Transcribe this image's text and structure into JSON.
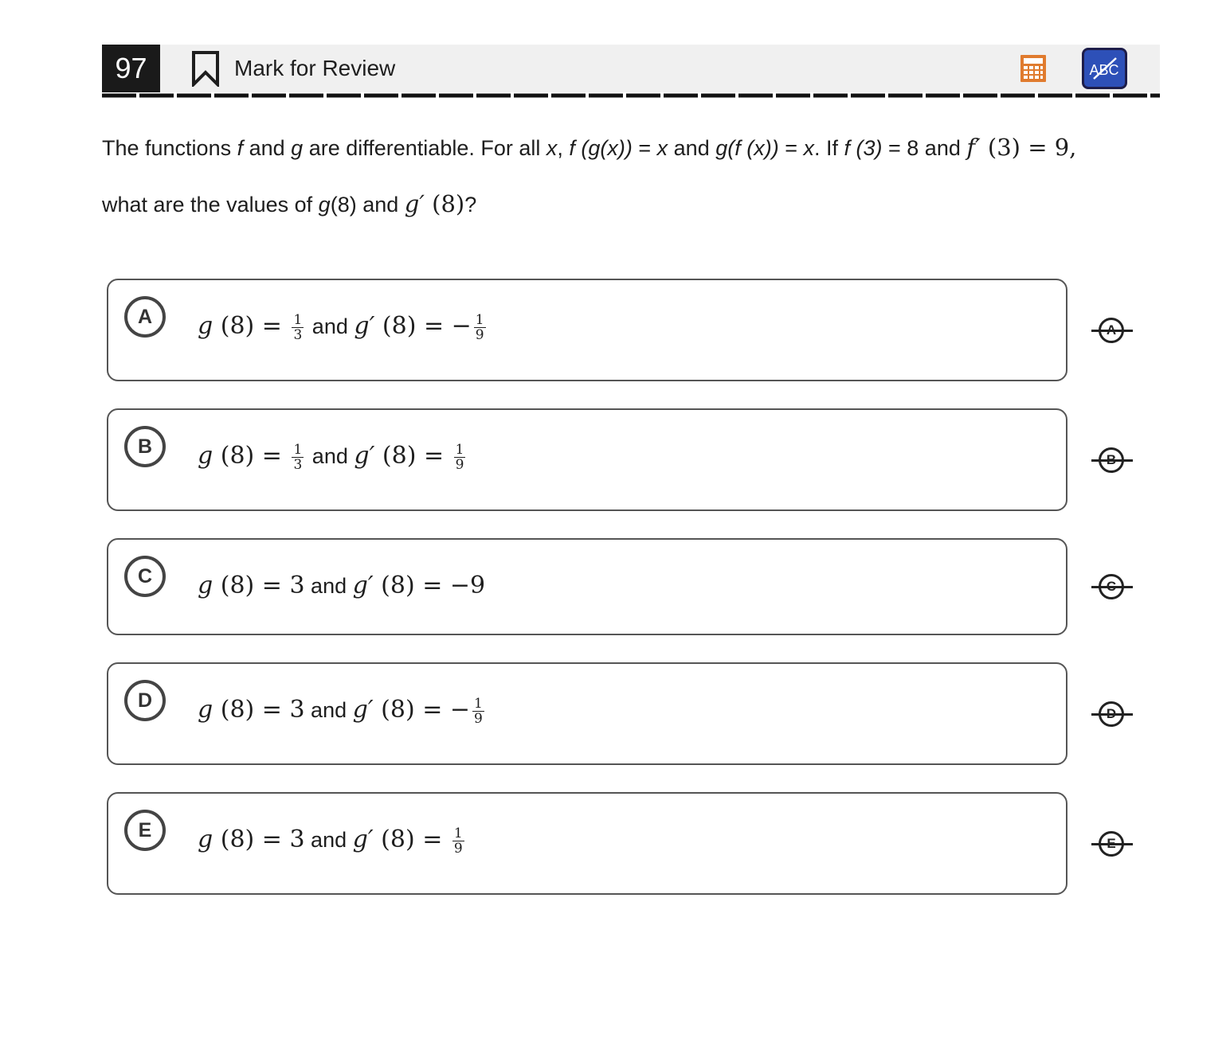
{
  "header": {
    "question_number": "97",
    "mark_label": "Mark for Review",
    "calculator_icon": "calculator-icon",
    "abc_icon": "abc-strikethrough-icon",
    "abc_text": "ABC",
    "accent_orange": "#e07b2e",
    "accent_blue": "#2d50b8"
  },
  "question": {
    "t1": "The functions ",
    "f": "f",
    "t2": " and ",
    "g": "g",
    "t3": " are differentiable. For all ",
    "x1": "x",
    "t4": ", ",
    "fg": "f (g(x))",
    "t5": " = ",
    "x2": "x",
    "t6": " and ",
    "gf": "g(f (x))",
    "t7": " = ",
    "x3": "x",
    "t8": ". If ",
    "f3": "f (3)",
    "t9": " = 8 and ",
    "fp": "f′",
    "fp3": " (3) = 9,",
    "t10": "what are the values of ",
    "g8": "g",
    "g8b": "(8) and ",
    "gp": "g′",
    "gp8": " (8)",
    "t11": "?"
  },
  "choices": [
    {
      "letter": "A",
      "lhs": "g",
      "lhs_arg": " (8) = ",
      "lhs_frac": {
        "num": "1",
        "den": "3"
      },
      "mid": " and ",
      "gp": "g′",
      "rhs_arg": " (8) = −",
      "rhs_frac": {
        "num": "1",
        "den": "9"
      }
    },
    {
      "letter": "B",
      "lhs": "g",
      "lhs_arg": " (8) = ",
      "lhs_frac": {
        "num": "1",
        "den": "3"
      },
      "mid": " and ",
      "gp": "g′",
      "rhs_arg": " (8) = ",
      "rhs_frac": {
        "num": "1",
        "den": "9"
      }
    },
    {
      "letter": "C",
      "lhs": "g",
      "lhs_arg": " (8) = 3",
      "mid": " and ",
      "gp": "g′",
      "rhs_arg": " (8) = −9"
    },
    {
      "letter": "D",
      "lhs": "g",
      "lhs_arg": " (8) = 3",
      "mid": " and ",
      "gp": "g′",
      "rhs_arg": " (8) = −",
      "rhs_frac": {
        "num": "1",
        "den": "9"
      }
    },
    {
      "letter": "E",
      "lhs": "g",
      "lhs_arg": " (8) = 3",
      "mid": " and ",
      "gp": "g′",
      "rhs_arg": " (8) = ",
      "rhs_frac": {
        "num": "1",
        "den": "9"
      }
    }
  ]
}
